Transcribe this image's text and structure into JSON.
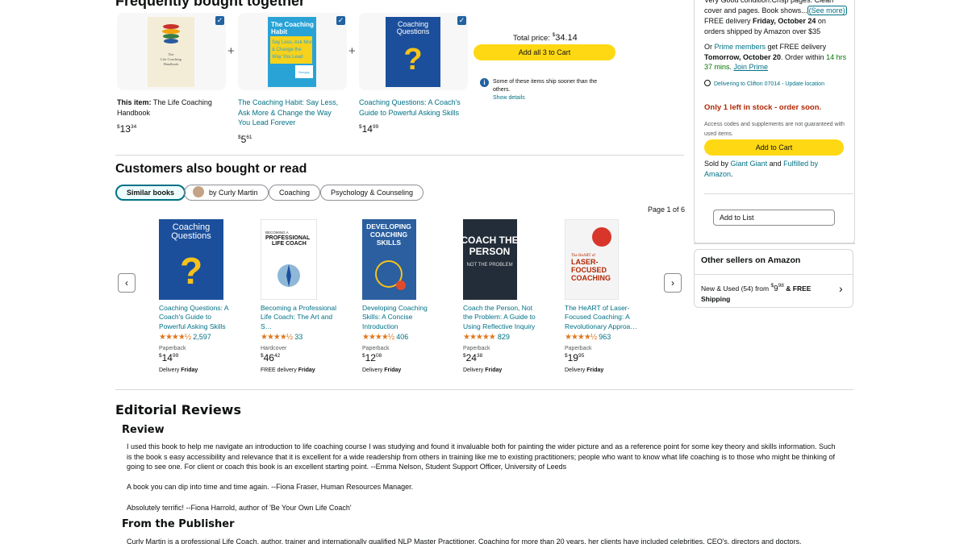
{
  "fbt": {
    "title": "Frequently bought together",
    "items": [
      {
        "prefix": "This item:",
        "title": "The Life Coaching Handbook",
        "price_whole": "13",
        "price_frac": "34",
        "cover_title": "The Life Coaching Handbook"
      },
      {
        "title": "The Coaching Habit: Say Less, Ask More & Change the Way You Lead Forever",
        "price_whole": "5",
        "price_frac": "61",
        "cover_title": "The Coaching Habit"
      },
      {
        "title": "Coaching Questions: A Coach's Guide to Powerful Asking Skills",
        "price_whole": "14",
        "price_frac": "99",
        "cover_title": "Coaching Questions"
      }
    ],
    "total_label": "Total price:",
    "total_value": "34.14",
    "add_all_label": "Add all 3 to Cart",
    "ship_note": "Some of these items ship sooner than the others.",
    "show_details": "Show details"
  },
  "customers": {
    "title": "Customers also bought or read",
    "tabs": [
      "Similar books",
      "by Curly Martin",
      "Coaching",
      "Psychology & Counseling"
    ],
    "page_label": "Page 1 of 6",
    "items": [
      {
        "title": "Coaching Questions: A Coach's Guide to Powerful Asking Skills",
        "stars": "★★★★½",
        "count": "2,597",
        "format": "Paperback",
        "price_whole": "14",
        "price_frac": "99",
        "delivery_pre": "Delivery",
        "delivery_day": "Friday",
        "cover_title": "Coaching Questions"
      },
      {
        "title": "Becoming a Professional Life Coach: The Art and S…",
        "stars": "★★★★½",
        "count": "33",
        "format": "Hardcover",
        "price_whole": "46",
        "price_frac": "42",
        "delivery_pre": "FREE delivery",
        "delivery_day": "Friday",
        "cover_title": "PROFESSIONAL LIFE COACH"
      },
      {
        "title": "Developing Coaching Skills: A Concise Introduction",
        "stars": "★★★★½",
        "count": "406",
        "format": "Paperback",
        "price_whole": "12",
        "price_frac": "08",
        "delivery_pre": "Delivery",
        "delivery_day": "Friday",
        "cover_title": "DEVELOPING COACHING SKILLS"
      },
      {
        "title": "Coach the Person, Not the Problem: A Guide to Using Reflective Inquiry",
        "stars": "★★★★★",
        "count": "829",
        "format": "Paperback",
        "price_whole": "24",
        "price_frac": "38",
        "delivery_pre": "Delivery",
        "delivery_day": "Friday",
        "cover_title": "COACH THE PERSON"
      },
      {
        "title": "The HeART of Laser-Focused Coaching: A Revolutionary Approa…",
        "stars": "★★★★½",
        "count": "963",
        "format": "Paperback",
        "price_whole": "19",
        "price_frac": "95",
        "delivery_pre": "Delivery",
        "delivery_day": "Friday",
        "cover_title": "LASER-FOCUSED COACHING"
      }
    ]
  },
  "editorial": {
    "title": "Editorial Reviews",
    "review_heading": "Review",
    "review_paragraphs": [
      "I used this book to help me navigate an introduction to life coaching course I was studying and found it invaluable both for painting the wider picture and as a reference point for some key theory and skills information. Such is the book s easy accessibility and relevance that it is excellent for a wide readership from others in training like me to existing practitioners; people who want to know what life coaching is to those who might be thinking of going to see one. For client or coach this book is an excellent starting point. --Emma Nelson, Student Support Officer, University of Leeds",
      "A book you can dip into time and time again. --Fiona Fraser, Human Resources Manager.",
      "Absolutely terrific! --Fiona Harrold, author of 'Be Your Own Life Coach'"
    ],
    "publisher_heading": "From the Publisher",
    "publisher_text": "Curly Martin is a professional Life Coach, author, trainer and internationally qualified NLP Master Practitioner. Coaching for more than 20 years, her clients have included celebrities, CEO's, directors and doctors."
  },
  "buybox": {
    "condition_text": "Very Good condition.Crisp pages. Clean cover and pages. Book shows...",
    "see_more": "(See more)",
    "free_delivery_pre": "FREE delivery",
    "free_delivery_date": "Friday, October 24",
    "free_delivery_post": "on orders shipped by Amazon over $35",
    "or_label": "Or",
    "prime_members": "Prime members",
    "prime_text": "get FREE delivery",
    "prime_date": "Tomorrow, October 20",
    "order_within_pre": ". Order within",
    "order_within": "14 hrs 37 mins",
    "join_prime": "Join Prime",
    "deliver_to": "Delivering to Clifton 07014 - Update location",
    "stock": "Only 1 left in stock - order soon.",
    "access_note": "Access codes and supplements are not guaranteed with used items.",
    "add_to_cart": "Add to Cart",
    "sold_by_label": "Sold by",
    "seller": "Giant Giant",
    "and": "and",
    "fulfilled": "Fulfilled by Amazon",
    "add_to_list": "Add to List"
  },
  "other_sellers": {
    "title": "Other sellers on Amazon",
    "row_label": "New & Used (54) from",
    "price_whole": "9",
    "price_frac": "98",
    "free_label": "& FREE Shipping"
  }
}
